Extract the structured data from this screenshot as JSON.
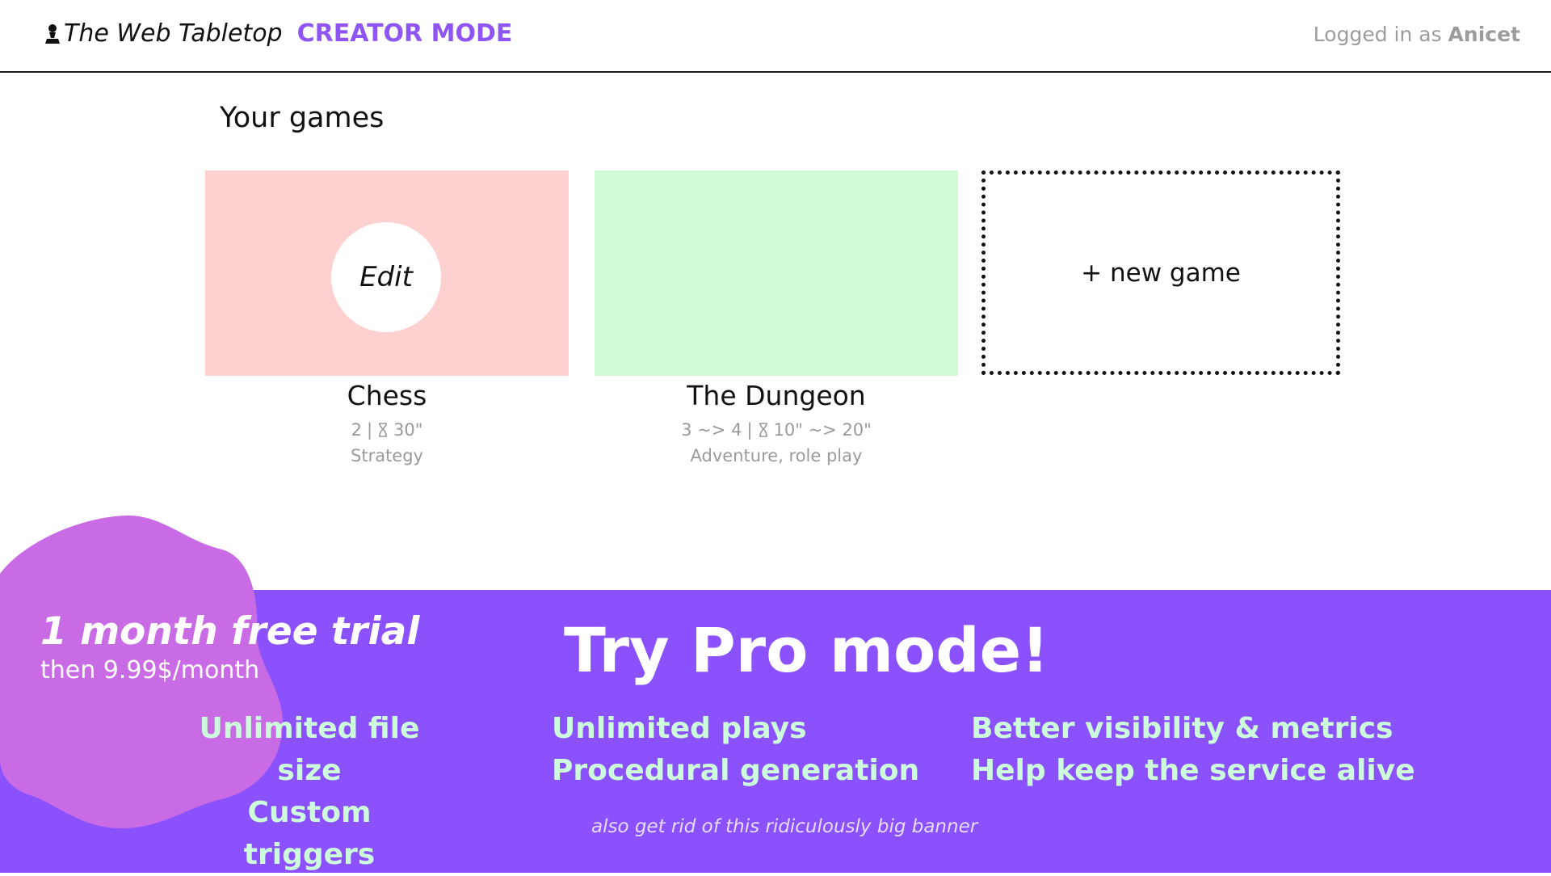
{
  "header": {
    "app_name": "The Web Tabletop",
    "mode": "CREATOR MODE",
    "login_prefix": "Logged in as ",
    "username": "Anicet"
  },
  "main": {
    "section_title": "Your games",
    "games": [
      {
        "title": "Chess",
        "players": "2",
        "duration": "30\"",
        "tags": "Strategy",
        "color": "#fed1d1",
        "edit_label": "Edit"
      },
      {
        "title": "The Dungeon",
        "players": "3 ~> 4",
        "duration": "10\" ~> 20\"",
        "tags": "Adventure, role play",
        "color": "#d0fdd6"
      }
    ],
    "new_game_label": "+ new game"
  },
  "banner": {
    "trial_title": "1 month free trial",
    "trial_price": "then 9.99$/month",
    "headline": "Try Pro mode!",
    "features": {
      "col1": [
        "Unlimited file size",
        "Custom triggers"
      ],
      "col2": [
        "Unlimited plays",
        "Procedural generation"
      ],
      "col3": [
        "Better visibility & metrics",
        "Help keep the service alive"
      ]
    },
    "footnote": "also get rid of this ridiculously big banner",
    "colors": {
      "background": "#8b51fd",
      "blob": "#c96be5",
      "feature_text": "#cdfcdc"
    }
  },
  "icons": [
    "pawn-icon",
    "hourglass-icon"
  ]
}
